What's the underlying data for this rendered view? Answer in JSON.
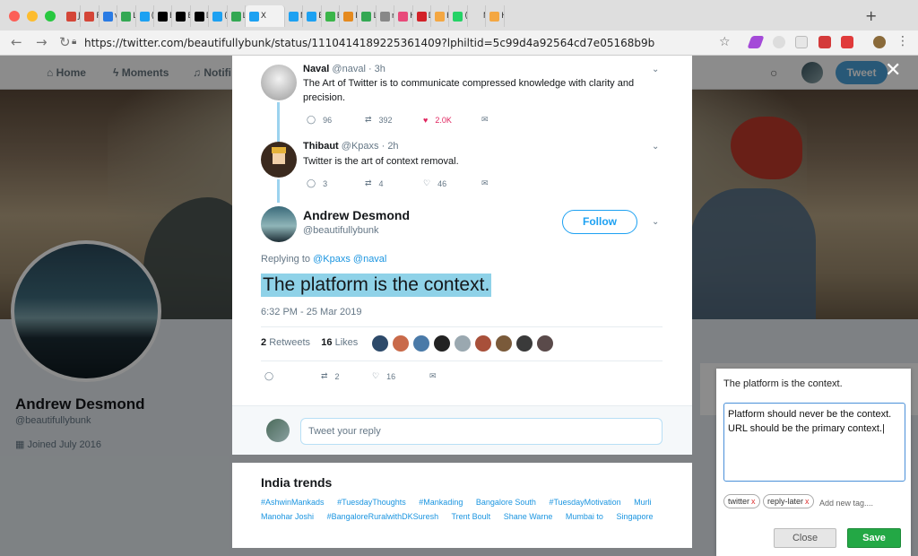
{
  "browser": {
    "tabs": [
      {
        "label": "Jı",
        "icon": "gmail-icon",
        "color": "#d44638"
      },
      {
        "label": "Ri",
        "icon": "gmail-icon",
        "color": "#d44638"
      },
      {
        "label": "vl",
        "icon": "shield-icon",
        "color": "#2a7be4"
      },
      {
        "label": "Lı",
        "icon": "meet-icon",
        "color": "#34a853"
      },
      {
        "label": "(*",
        "icon": "twitter-icon",
        "color": "#1da1f2"
      },
      {
        "label": "Eı",
        "icon": "medium-icon",
        "color": "#000000"
      },
      {
        "label": "Eı",
        "icon": "medium-icon",
        "color": "#000000"
      },
      {
        "label": "D",
        "icon": "medium-icon",
        "color": "#000000"
      },
      {
        "label": "(1",
        "icon": "twitter-icon",
        "color": "#1da1f2"
      },
      {
        "label": "Lı",
        "icon": "meet-icon",
        "color": "#34a853"
      },
      {
        "label": "X",
        "icon": "twitter-icon",
        "color": "#1da1f2",
        "active": true
      },
      {
        "label": "N",
        "icon": "twitter-icon",
        "color": "#1da1f2"
      },
      {
        "label": "B",
        "icon": "twitter-icon",
        "color": "#1da1f2"
      },
      {
        "label": "B",
        "icon": "px-icon",
        "color": "#3bb54a"
      },
      {
        "label": "N",
        "icon": "shield-icon",
        "color": "#e58a1f"
      },
      {
        "label": "Lı",
        "icon": "meet-icon",
        "color": "#34a853"
      },
      {
        "label": "m",
        "icon": "doc-icon",
        "color": "#888888"
      },
      {
        "label": "H",
        "icon": "k-icon",
        "color": "#e84a7a"
      },
      {
        "label": "D",
        "icon": "z-icon",
        "color": "#d22128"
      },
      {
        "label": "H",
        "icon": "rainbow-icon",
        "color": "#f4a742"
      },
      {
        "label": "(1",
        "icon": "whatsapp-icon",
        "color": "#25d366"
      },
      {
        "label": "New",
        "icon": "newtab-icon",
        "color": "#dedede"
      },
      {
        "label": "H",
        "icon": "rainbow-icon",
        "color": "#f4a742"
      }
    ],
    "url": "https://twitter.com/beautifullybunk/status/1110414189225361409?lphiltid=5c99d4a92564cd7e05168b9b",
    "new_tab_label": "+"
  },
  "twitter_nav": {
    "home": "Home",
    "moments": "Moments",
    "notifications": "Notifi",
    "tweet_button": "Tweet"
  },
  "profile": {
    "name": "Andrew Desmond",
    "handle": "@beautifullybunk",
    "joined": "Joined July 2016"
  },
  "thread": [
    {
      "name": "Naval",
      "handle": "@naval",
      "time": "· 3h",
      "text": "The Art of Twitter is to communicate compressed knowledge with clarity and precision.",
      "replies": "96",
      "retweets": "392",
      "likes": "2.0K"
    },
    {
      "name": "Thibaut",
      "handle": "@Kpaxs",
      "time": "· 2h",
      "text": "Twitter is the art of context removal.",
      "replies": "3",
      "retweets": "4",
      "likes": "46"
    }
  ],
  "main_tweet": {
    "name": "Andrew Desmond",
    "handle": "@beautifullybunk",
    "follow": "Follow",
    "replying_prefix": "Replying to",
    "replying_mentions": "@Kpaxs @naval",
    "text": "The platform is the context.",
    "timestamp": "6:32 PM - 25 Mar 2019",
    "retweets_count": "2",
    "retweets_label": "Retweets",
    "likes_count": "16",
    "likes_label": "Likes",
    "reply_count": "",
    "retweet_action": "2",
    "like_action": "16"
  },
  "reply_box": {
    "placeholder": "Tweet your reply"
  },
  "trends": {
    "title": "India trends",
    "items": [
      "#AshwinMankads",
      "#TuesdayThoughts",
      "#Mankading",
      "Bangalore South",
      "#TuesdayMotivation",
      "Murli Manohar Joshi",
      "#BangaloreRuralwithDKSuresh",
      "Trent Boult",
      "Shane Warne",
      "Mumbai to",
      "Singapore"
    ]
  },
  "notes_panel": {
    "title": "The platform is the context.",
    "note_line1": "Platform should never be the context.",
    "note_line2": "URL should be the primary context.",
    "tags": [
      "twitter",
      "reply-later"
    ],
    "tag_remove": "x",
    "add_tag": "Add new tag....",
    "close": "Close",
    "save": "Save"
  },
  "colors": {
    "twitter_blue": "#1da1f2",
    "like_red": "#e0245e",
    "save_green": "#23a845",
    "highlight": "#8fd2e8"
  }
}
